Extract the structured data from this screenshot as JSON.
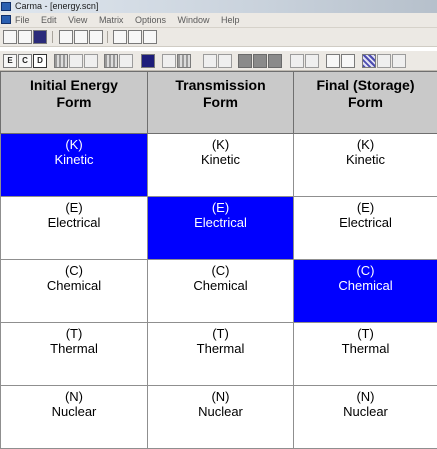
{
  "window": {
    "title": "Carma - [energy.scn]"
  },
  "menu": [
    "File",
    "Edit",
    "View",
    "Matrix",
    "Options",
    "Window",
    "Help"
  ],
  "toolbar1": [
    {
      "icon": "new-file-icon"
    },
    {
      "icon": "open-folder-icon"
    },
    {
      "icon": "save-icon"
    },
    {
      "icon": "cut-icon"
    },
    {
      "icon": "copy-icon"
    },
    {
      "icon": "paste-icon"
    },
    {
      "icon": "print-preview-icon"
    },
    {
      "icon": "print-icon"
    },
    {
      "icon": "help-icon"
    }
  ],
  "toolbar2": [
    {
      "label": "E"
    },
    {
      "label": "C"
    },
    {
      "label": "D"
    }
  ],
  "headers": [
    "Initial Energy\nForm",
    "Transmission\nForm",
    "Final (Storage)\nForm"
  ],
  "header_lines": [
    [
      "Initial Energy",
      "Form"
    ],
    [
      "Transmission",
      "Form"
    ],
    [
      "Final (Storage)",
      "Form"
    ]
  ],
  "rows": [
    {
      "code": "(K)",
      "name": "Kinetic",
      "selected_col": 0
    },
    {
      "code": "(E)",
      "name": "Electrical",
      "selected_col": 1
    },
    {
      "code": "(C)",
      "name": "Chemical",
      "selected_col": 2
    },
    {
      "code": "(T)",
      "name": "Thermal",
      "selected_col": -1
    },
    {
      "code": "(N)",
      "name": "Nuclear",
      "selected_col": -1
    }
  ],
  "colors": {
    "selected": "#0000ff",
    "header_bg": "#c9c9c9"
  }
}
